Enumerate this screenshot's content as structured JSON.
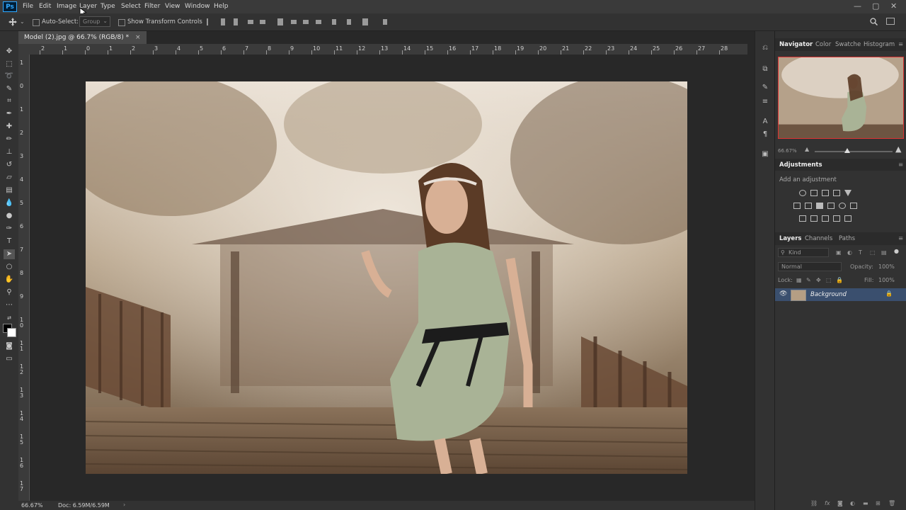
{
  "app": {
    "logo": "Ps"
  },
  "menu": [
    "File",
    "Edit",
    "Image",
    "Layer",
    "Type",
    "Select",
    "Filter",
    "View",
    "Window",
    "Help"
  ],
  "window_controls": [
    "—",
    "▢",
    "✕"
  ],
  "options_bar": {
    "auto_select_label": "Auto-Select:",
    "auto_select_value": "Group",
    "transform_label": "Show Transform Controls"
  },
  "document": {
    "tab_title": "Model (2).jpg @ 66.7% (RGB/8) *"
  },
  "ruler_top_labels": [
    "2",
    "1",
    "0",
    "1",
    "2",
    "3",
    "4",
    "5",
    "6",
    "7",
    "8",
    "9",
    "10",
    "11",
    "12",
    "13",
    "14",
    "15",
    "16",
    "17",
    "18",
    "19",
    "20",
    "21",
    "22",
    "23",
    "24",
    "25",
    "26",
    "27",
    "28"
  ],
  "ruler_left_labels": [
    "1",
    "0",
    "1",
    "2",
    "3",
    "4",
    "5",
    "6",
    "7",
    "8",
    "9",
    "1 0",
    "1 1",
    "1 2",
    "1 3",
    "1 4",
    "1 5",
    "1 6",
    "1 7"
  ],
  "status": {
    "zoom": "66.67%",
    "doc": "Doc: 6.59M/6.59M"
  },
  "navigator": {
    "tabs": [
      "Navigator",
      "Color",
      "Swatches",
      "Histogram"
    ],
    "zoom": "66.67%"
  },
  "adjustments": {
    "title": "Adjustments",
    "subtitle": "Add an adjustment"
  },
  "layers": {
    "tabs": [
      "Layers",
      "Channels",
      "Paths"
    ],
    "kind_label": "Kind",
    "blend_mode": "Normal",
    "opacity_label": "Opacity:",
    "opacity_value": "100%",
    "lock_label": "Lock:",
    "fill_label": "Fill:",
    "fill_value": "100%",
    "items": [
      {
        "name": "Background",
        "locked": true
      }
    ]
  },
  "colors": {
    "accent": "#31a8ff",
    "nav_frame": "#dd3333",
    "layer_selected": "#3a4f6e"
  }
}
